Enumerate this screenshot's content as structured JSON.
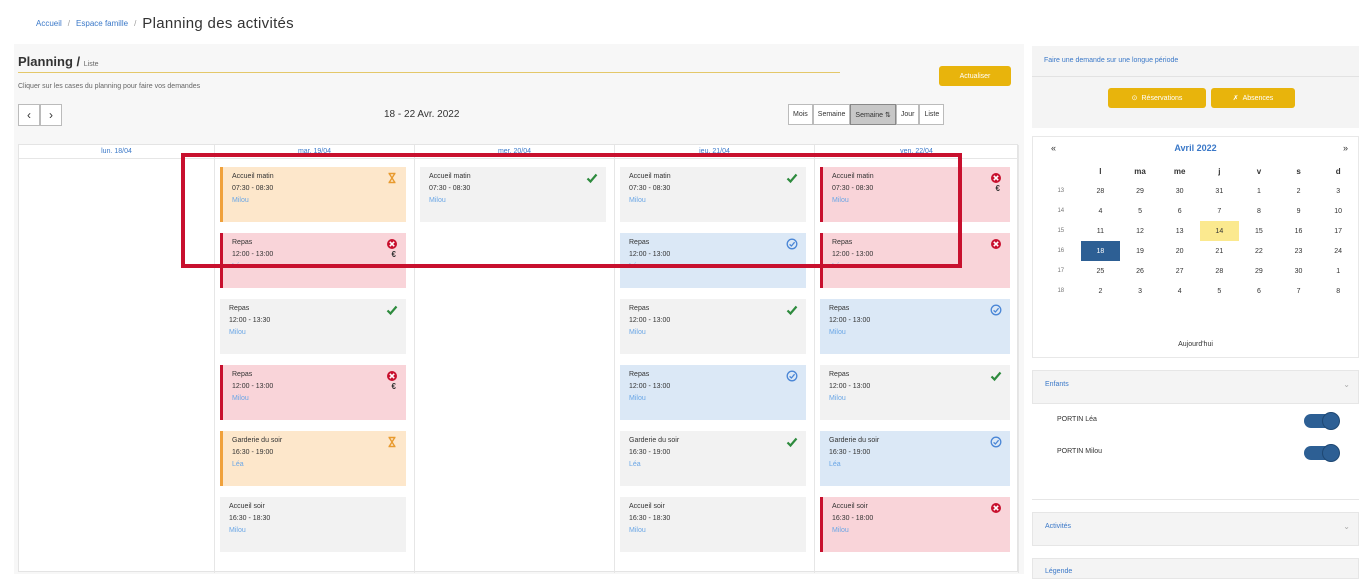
{
  "breadcrumb": {
    "home": "Accueil",
    "family": "Espace famille",
    "sep": "/"
  },
  "page_title": "Planning des activités",
  "planning": {
    "title": "Planning /",
    "subtitle": "Liste",
    "hint": "Cliquer sur les cases du planning pour faire vos demandes",
    "refresh_label": "Actualiser",
    "date_range": "18 - 22 Avr. 2022",
    "nav_prev": "‹",
    "nav_next": "›",
    "views": [
      "Mois",
      "Semaine",
      "Semaine ⇅",
      "Jour",
      "Liste"
    ],
    "days": [
      {
        "label": "lun. 18/04",
        "cards": []
      },
      {
        "label": "mar. 19/04",
        "cards": [
          {
            "title": "Accueil matin",
            "time": "07:30 - 08:30",
            "child": "Milou",
            "color": "orange",
            "status": "wait",
            "euro": false
          },
          {
            "title": "Repas",
            "time": "12:00 - 13:00",
            "child": "Léa",
            "color": "pink",
            "status": "refused",
            "euro": true
          },
          {
            "title": "Repas",
            "time": "12:00 - 13:30",
            "child": "Milou",
            "color": "gray",
            "status": "ok",
            "euro": false
          },
          {
            "title": "Repas",
            "time": "12:00 - 13:00",
            "child": "Milou",
            "color": "pink",
            "status": "refused",
            "euro": true
          },
          {
            "title": "Garderie du soir",
            "time": "16:30 - 19:00",
            "child": "Léa",
            "color": "orange",
            "status": "wait",
            "euro": false
          },
          {
            "title": "Accueil soir",
            "time": "16:30 - 18:30",
            "child": "Milou",
            "color": "gray",
            "status": "none",
            "euro": false
          }
        ]
      },
      {
        "label": "mer. 20/04",
        "cards": [
          {
            "title": "Accueil matin",
            "time": "07:30 - 08:30",
            "child": "Milou",
            "color": "gray",
            "status": "ok",
            "euro": false
          }
        ]
      },
      {
        "label": "jeu. 21/04",
        "cards": [
          {
            "title": "Accueil matin",
            "time": "07:30 - 08:30",
            "child": "Milou",
            "color": "gray",
            "status": "ok",
            "euro": false
          },
          {
            "title": "Repas",
            "time": "12:00 - 13:00",
            "child": "Léa",
            "color": "blue",
            "status": "pending",
            "euro": false
          },
          {
            "title": "Repas",
            "time": "12:00 - 13:00",
            "child": "Milou",
            "color": "gray",
            "status": "ok",
            "euro": false
          },
          {
            "title": "Repas",
            "time": "12:00 - 13:00",
            "child": "Milou",
            "color": "blue",
            "status": "pending",
            "euro": false
          },
          {
            "title": "Garderie du soir",
            "time": "16:30 - 19:00",
            "child": "Léa",
            "color": "gray",
            "status": "ok",
            "euro": false
          },
          {
            "title": "Accueil soir",
            "time": "16:30 - 18:30",
            "child": "Milou",
            "color": "gray",
            "status": "none",
            "euro": false
          }
        ]
      },
      {
        "label": "ven. 22/04",
        "cards": [
          {
            "title": "Accueil matin",
            "time": "07:30 - 08:30",
            "child": "Milou",
            "color": "pink",
            "status": "refused",
            "euro": true
          },
          {
            "title": "Repas",
            "time": "12:00 - 13:00",
            "child": "Léa",
            "color": "pink",
            "status": "refused",
            "euro": false
          },
          {
            "title": "Repas",
            "time": "12:00 - 13:00",
            "child": "Milou",
            "color": "blue",
            "status": "pending",
            "euro": false
          },
          {
            "title": "Repas",
            "time": "12:00 - 13:00",
            "child": "Milou",
            "color": "gray",
            "status": "ok",
            "euro": false
          },
          {
            "title": "Garderie du soir",
            "time": "16:30 - 19:00",
            "child": "Léa",
            "color": "blue",
            "status": "pending",
            "euro": false
          },
          {
            "title": "Accueil soir",
            "time": "16:30 - 18:00",
            "child": "Milou",
            "color": "pink",
            "status": "refused",
            "euro": false
          }
        ]
      }
    ]
  },
  "sidebar": {
    "period_title": "Faire une demande sur une longue période",
    "reservations_label": "Réservations",
    "absences_label": "Absences",
    "calendar": {
      "month": "Avril 2022",
      "prev": "«",
      "next": "»",
      "weekdays": [
        "l",
        "ma",
        "me",
        "j",
        "v",
        "s",
        "d"
      ],
      "weeks": [
        {
          "wk": "13",
          "days": [
            "28",
            "29",
            "30",
            "31",
            "1",
            "2",
            "3"
          ]
        },
        {
          "wk": "14",
          "days": [
            "4",
            "5",
            "6",
            "7",
            "8",
            "9",
            "10"
          ]
        },
        {
          "wk": "15",
          "days": [
            "11",
            "12",
            "13",
            "14",
            "15",
            "16",
            "17"
          ]
        },
        {
          "wk": "16",
          "days": [
            "18",
            "19",
            "20",
            "21",
            "22",
            "23",
            "24"
          ]
        },
        {
          "wk": "17",
          "days": [
            "25",
            "26",
            "27",
            "28",
            "29",
            "30",
            "1"
          ]
        },
        {
          "wk": "18",
          "days": [
            "2",
            "3",
            "4",
            "5",
            "6",
            "7",
            "8"
          ]
        }
      ],
      "today": "14",
      "selected": "18",
      "today_label": "Aujourd'hui"
    },
    "children_title": "Enfants",
    "children": [
      {
        "name": "PORTIN Léa",
        "enabled": true
      },
      {
        "name": "PORTIN Milou",
        "enabled": true
      }
    ],
    "activities_title": "Activités",
    "legend_title": "Légende"
  },
  "colors": {
    "accent": "#e8b40c",
    "link": "#3a78c8",
    "ok": "#2e8b3e",
    "refused": "#c8102e",
    "pending": "#4a86d6",
    "highlight": "#c8102e"
  }
}
